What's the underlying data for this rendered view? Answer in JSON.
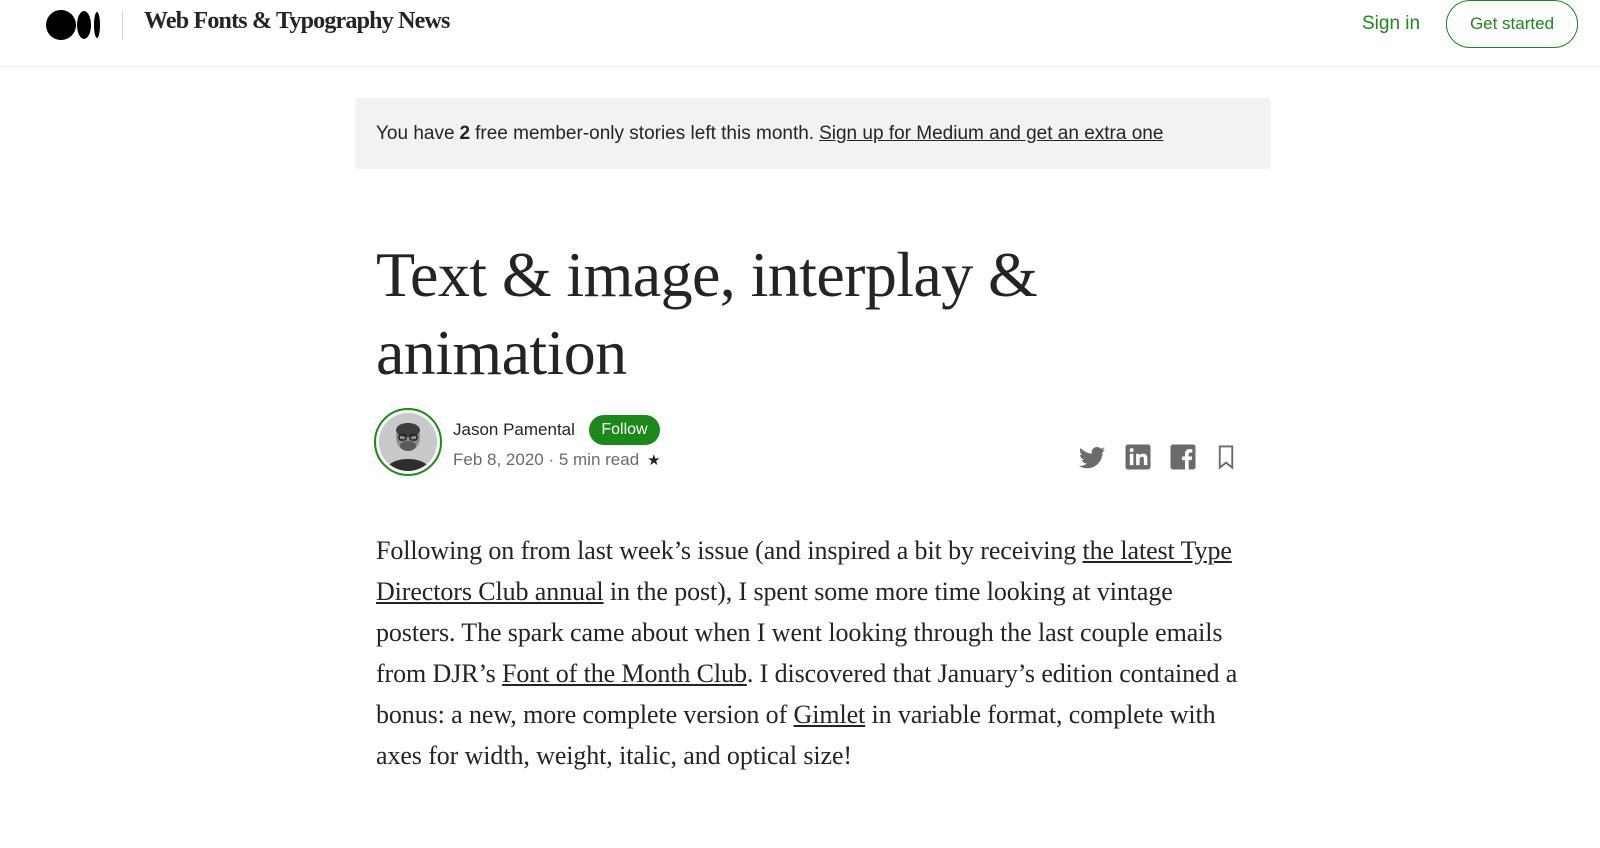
{
  "header": {
    "publication_name": "Web Fonts & Typography News",
    "signin_label": "Sign in",
    "get_started_label": "Get started"
  },
  "banner": {
    "text_before": "You have",
    "count": "2",
    "text_after": "free member-only stories left this month.",
    "link_label": "Sign up for Medium and get an extra one"
  },
  "article": {
    "title": "Text & image, interplay & animation",
    "author": {
      "name": "Jason Pamental",
      "follow_label": "Follow",
      "meta": "Feb 8, 2020 · 5 min read",
      "star": "★"
    },
    "share_icons": [
      "twitter-icon",
      "linkedin-icon",
      "facebook-icon",
      "bookmark-icon"
    ],
    "paragraph": {
      "p1": "Following on from last week’s issue (and inspired a bit by receiving ",
      "link1": "the latest Type Directors Club annual",
      "p2": " in the post), I spent some more time looking at vintage posters. The spark came about when I went looking through the last couple emails from DJR’s ",
      "link2": "Font of the Month Club",
      "p3": ". I discovered that January’s edition contained a bonus: a new, more complete version of ",
      "link3": "Gimlet",
      "p4": " in variable format, complete with axes for width, weight, italic, and optical size!"
    }
  },
  "colors": {
    "accent_green": "#1a8917",
    "text": "#242424",
    "muted": "#6b6b6b",
    "banner_bg": "#f2f2f2"
  }
}
